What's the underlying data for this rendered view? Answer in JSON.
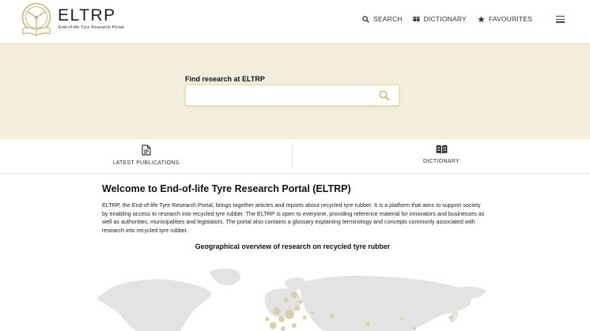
{
  "header": {
    "logo_title": "ELTRP",
    "logo_subtitle": "End-of-life Tyre Research Portal",
    "nav": [
      {
        "label": "SEARCH",
        "icon": "search-icon"
      },
      {
        "label": "DICTIONARY",
        "icon": "book-icon"
      },
      {
        "label": "FAVOURITES",
        "icon": "star-icon"
      }
    ],
    "menu_icon": "hamburger-menu-icon"
  },
  "hero": {
    "label": "Find research at ELTRP",
    "search_value": "",
    "search_placeholder": ""
  },
  "quick_links": [
    {
      "label": "LATEST PUBLICATIONS",
      "icon": "document-icon"
    },
    {
      "label": "DICTIONARY",
      "icon": "book-icon"
    }
  ],
  "main": {
    "title": "Welcome to End-of-life Tyre Research Portal (ELTRP)",
    "intro": "ELTRP, the End-of-life Tyre Research Portal, brings together articles and reports about recycled tyre rubber. It is a platform that aims to support society by enabling access to research into recycled tyre rubber. The ELTRP is open to everyone, providing reference material for innovators and businesses as well as authorities, municipalities and legislators. The portal also contains a glossary explaining terminology and concepts commonly associated with research into recycled tyre rubber.",
    "map_title": "Geographical overview of research on recycled tyre rubber"
  },
  "colors": {
    "brand_gold": "#c8b47a",
    "hero_background": "#f2eedb",
    "map_land": "#e3e3e3",
    "map_marker": "#d9cfa8"
  }
}
